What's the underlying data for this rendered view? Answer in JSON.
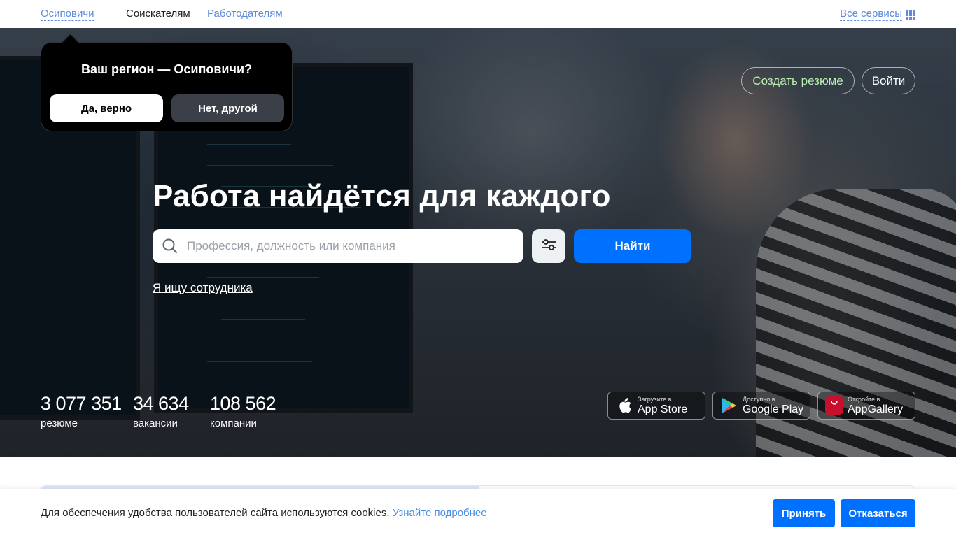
{
  "topnav": {
    "city": "Осиповичи",
    "seekers": "Соискателям",
    "employers": "Работодателям",
    "all_services": "Все сервисы"
  },
  "region_popup": {
    "question": "Ваш регион — Осиповичи?",
    "yes": "Да, верно",
    "no": "Нет, другой"
  },
  "header_buttons": {
    "create_resume": "Создать резюме",
    "login": "Войти"
  },
  "hero": {
    "title": "Работа найдётся для каждого",
    "search_placeholder": "Профессия, должность или компания",
    "find_button": "Найти",
    "employer_link": "Я ищу сотрудника"
  },
  "stats": [
    {
      "value": "3 077 351",
      "label": "резюме"
    },
    {
      "value": "34 634",
      "label": "вакансии"
    },
    {
      "value": "108 562",
      "label": "компании"
    }
  ],
  "app_badges": [
    {
      "small": "Загрузите в",
      "big": "App Store",
      "icon": "apple-icon"
    },
    {
      "small": "Доступно в",
      "big": "Google Play",
      "icon": "google-play-icon"
    },
    {
      "small": "Откройте в",
      "big": "AppGallery",
      "icon": "huawei-icon"
    }
  ],
  "cookie": {
    "text": "Для обеспечения удобства пользователей сайта используются cookies.",
    "link": "Узнайте подробнее",
    "accept": "Принять",
    "decline": "Отказаться"
  },
  "colors": {
    "primary": "#0070ff",
    "link": "#5e8ad8",
    "resume_button_text": "#b8f0b0"
  }
}
